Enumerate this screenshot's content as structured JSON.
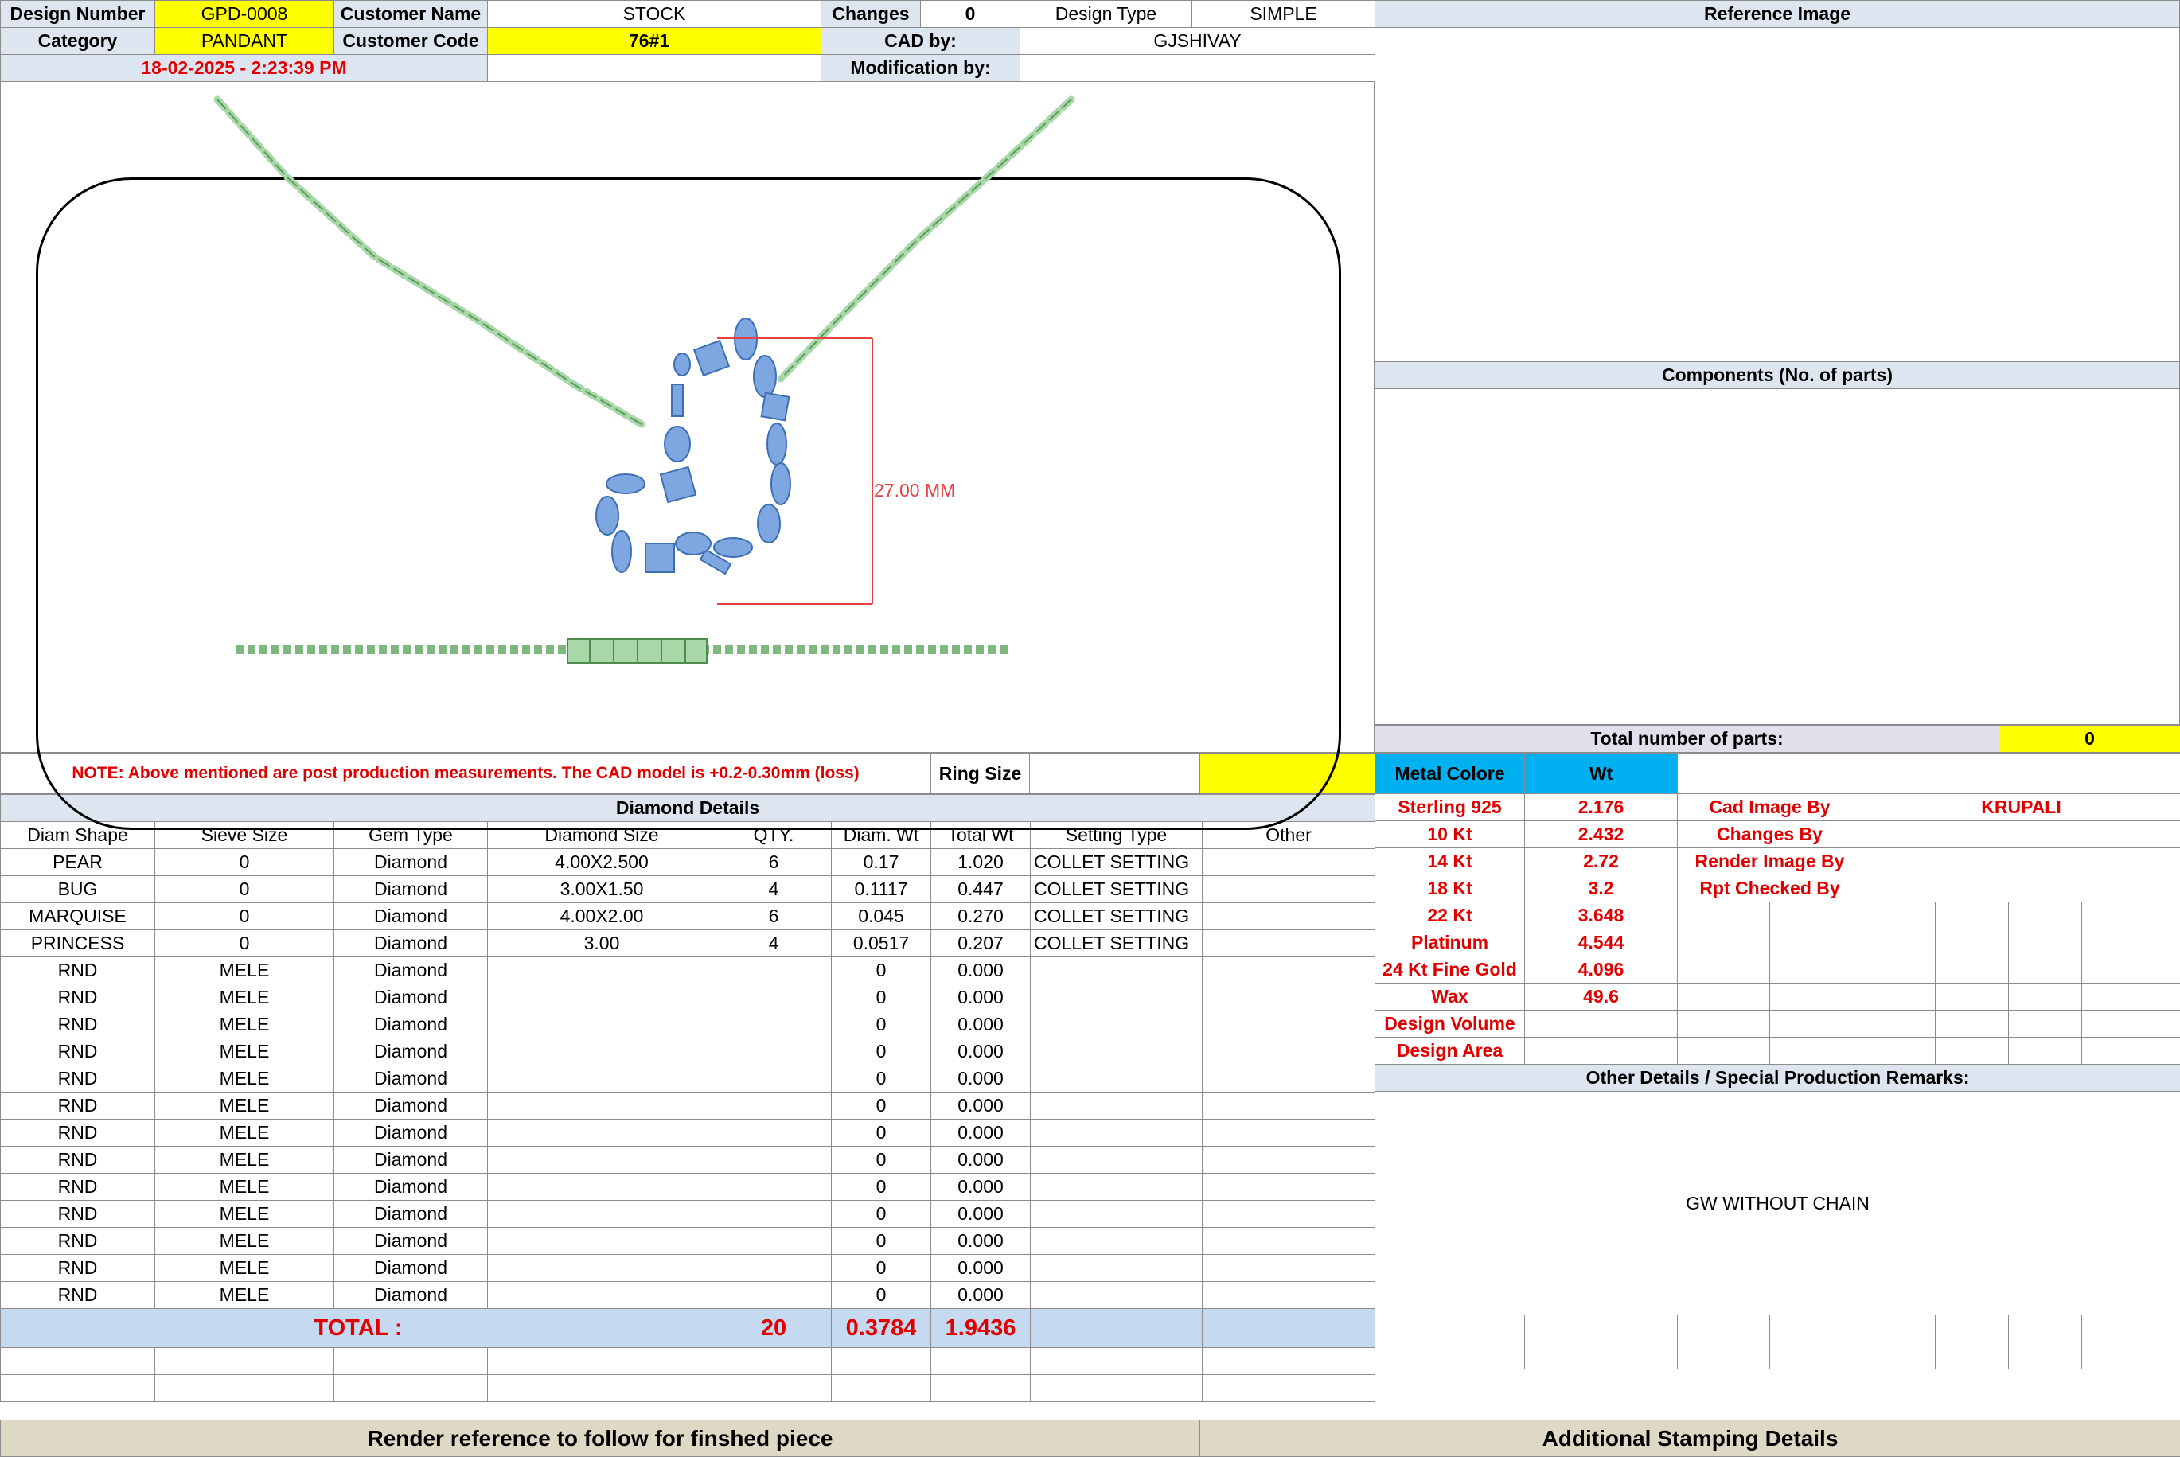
{
  "header": {
    "design_number_label": "Design Number",
    "design_number": "GPD-0008",
    "customer_name_label": "Customer Name",
    "customer_name": "STOCK",
    "changes_label": "Changes",
    "changes": "0",
    "design_type_label": "Design Type",
    "design_type": "SIMPLE",
    "category_label": "Category",
    "category": "PANDANT",
    "customer_code_label": "Customer Code",
    "customer_code": "76#1_",
    "cad_by_label": "CAD by:",
    "cad_by": "GJSHIVAY",
    "datetime": "18-02-2025 - 2:23:39 PM",
    "modification_by_label": "Modification by:",
    "modification_by": ""
  },
  "render": {
    "dimension_label": "27.00 MM"
  },
  "note": {
    "text": "NOTE: Above mentioned are post production measurements. The CAD model is +0.2-0.30mm (loss)",
    "ring_size_label": "Ring Size",
    "ring_size": ""
  },
  "diamond_details": {
    "title": "Diamond Details",
    "columns": [
      "Diam Shape",
      "Sieve Size",
      "Gem Type",
      "Diamond Size",
      "QTY.",
      "Diam. Wt",
      "Total Wt",
      "Setting Type",
      "Other"
    ],
    "rows": [
      [
        "PEAR",
        "0",
        "Diamond",
        "4.00X2.500",
        "6",
        "0.17",
        "1.020",
        "COLLET SETTING",
        ""
      ],
      [
        "BUG",
        "0",
        "Diamond",
        "3.00X1.50",
        "4",
        "0.1117",
        "0.447",
        "COLLET SETTING",
        ""
      ],
      [
        "MARQUISE",
        "0",
        "Diamond",
        "4.00X2.00",
        "6",
        "0.045",
        "0.270",
        "COLLET SETTING",
        ""
      ],
      [
        "PRINCESS",
        "0",
        "Diamond",
        "3.00",
        "4",
        "0.0517",
        "0.207",
        "COLLET SETTING",
        ""
      ],
      [
        "RND",
        "MELE",
        "Diamond",
        "",
        "",
        "0",
        "0.000",
        "",
        ""
      ],
      [
        "RND",
        "MELE",
        "Diamond",
        "",
        "",
        "0",
        "0.000",
        "",
        ""
      ],
      [
        "RND",
        "MELE",
        "Diamond",
        "",
        "",
        "0",
        "0.000",
        "",
        ""
      ],
      [
        "RND",
        "MELE",
        "Diamond",
        "",
        "",
        "0",
        "0.000",
        "",
        ""
      ],
      [
        "RND",
        "MELE",
        "Diamond",
        "",
        "",
        "0",
        "0.000",
        "",
        ""
      ],
      [
        "RND",
        "MELE",
        "Diamond",
        "",
        "",
        "0",
        "0.000",
        "",
        ""
      ],
      [
        "RND",
        "MELE",
        "Diamond",
        "",
        "",
        "0",
        "0.000",
        "",
        ""
      ],
      [
        "RND",
        "MELE",
        "Diamond",
        "",
        "",
        "0",
        "0.000",
        "",
        ""
      ],
      [
        "RND",
        "MELE",
        "Diamond",
        "",
        "",
        "0",
        "0.000",
        "",
        ""
      ],
      [
        "RND",
        "MELE",
        "Diamond",
        "",
        "",
        "0",
        "0.000",
        "",
        ""
      ],
      [
        "RND",
        "MELE",
        "Diamond",
        "",
        "",
        "0",
        "0.000",
        "",
        ""
      ],
      [
        "RND",
        "MELE",
        "Diamond",
        "",
        "",
        "0",
        "0.000",
        "",
        ""
      ],
      [
        "RND",
        "MELE",
        "Diamond",
        "",
        "",
        "0",
        "0.000",
        "",
        ""
      ]
    ],
    "total_label": "TOTAL :",
    "total_qty": "20",
    "total_diam_wt": "0.3784",
    "total_wt": "1.9436"
  },
  "right_panel": {
    "reference_image_label": "Reference Image",
    "components_label": "Components (No. of parts)",
    "total_parts_label": "Total number of parts:",
    "total_parts": "0",
    "metal_color_label": "Metal Colore",
    "wt_label": "Wt",
    "metals": [
      {
        "name": "Sterling 925",
        "wt": "2.176"
      },
      {
        "name": "10 Kt",
        "wt": "2.432"
      },
      {
        "name": "14 Kt",
        "wt": "2.72"
      },
      {
        "name": "18 Kt",
        "wt": "3.2"
      },
      {
        "name": "22 Kt",
        "wt": "3.648"
      },
      {
        "name": "Platinum",
        "wt": "4.544"
      },
      {
        "name": "24 Kt Fine Gold",
        "wt": "4.096"
      },
      {
        "name": "Wax",
        "wt": "49.6"
      },
      {
        "name": "Design Volume",
        "wt": ""
      },
      {
        "name": "Design Area",
        "wt": ""
      }
    ],
    "credits": [
      {
        "label": "Cad Image By",
        "value": "KRUPALI"
      },
      {
        "label": "Changes By",
        "value": ""
      },
      {
        "label": "Render Image By",
        "value": ""
      },
      {
        "label": "Rpt Checked By",
        "value": ""
      }
    ],
    "other_details_label": "Other Details / Special Production Remarks:",
    "remarks": "GW WITHOUT CHAIN"
  },
  "footer": {
    "render_reference": "Render reference to follow for finshed piece",
    "stamping": "Additional Stamping Details"
  },
  "colors": {
    "label_bg": "#dde6f0",
    "highlight_yellow": "#ffff00",
    "accent_red": "#e00000",
    "metal_header_cyan": "#00b0f0",
    "footer_beige": "#ddd9c4",
    "total_row_blue": "#c5d9f1"
  }
}
